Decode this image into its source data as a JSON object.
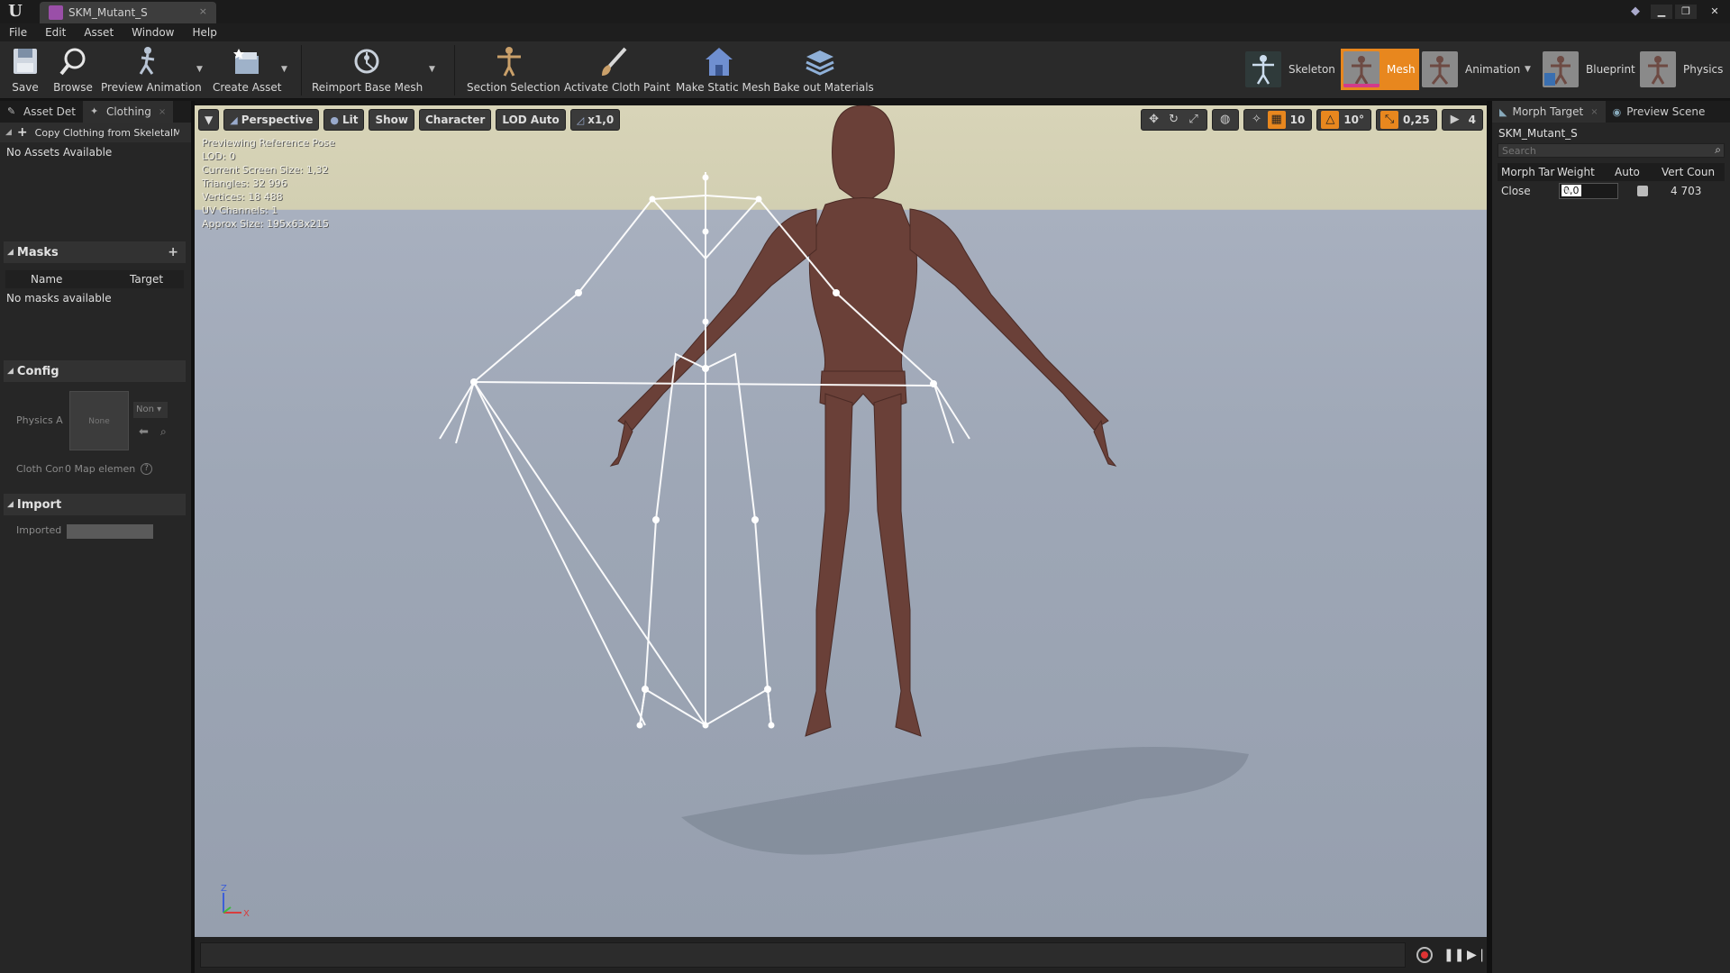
{
  "window": {
    "tab_title": "SKM_Mutant_S",
    "tab_close": "×",
    "controls": {
      "minimize": "▁",
      "restore": "❐",
      "close": "✕"
    }
  },
  "menubar": [
    "File",
    "Edit",
    "Asset",
    "Window",
    "Help"
  ],
  "toolbar": {
    "save": "Save",
    "browse": "Browse",
    "preview_animation": "Preview Animation",
    "create_asset": "Create Asset",
    "reimport_base_mesh": "Reimport Base Mesh",
    "section_selection": "Section Selection",
    "activate_cloth_paint": "Activate Cloth Paint",
    "make_static_mesh": "Make Static Mesh",
    "bake_out_materials": "Bake out Materials",
    "dropdown_arrow": "▼"
  },
  "modes": {
    "skeleton": "Skeleton",
    "mesh": "Mesh",
    "animation": "Animation",
    "blueprint": "Blueprint",
    "physics": "Physics",
    "active": "Mesh"
  },
  "left_panel": {
    "tabs": {
      "asset_details": "Asset Det",
      "clothing": "Clothing"
    },
    "copy_clothing": "Copy Clothing from SkeletalMes",
    "no_assets": "No Assets Available",
    "masks": {
      "title": "Masks",
      "col_name": "Name",
      "col_target": "Target",
      "empty": "No masks available"
    },
    "config": {
      "title": "Config",
      "physics_asset_label": "Physics A",
      "thumb_text": "None",
      "combo_value": "Non",
      "cloth_config_label": "Cloth Con",
      "map_elements": "0 Map elemen",
      "help": "?"
    },
    "import": {
      "title": "Import",
      "imported_label": "Imported I"
    }
  },
  "viewport": {
    "menu_arrow": "▼",
    "perspective": "Perspective",
    "lit": "Lit",
    "show": "Show",
    "character": "Character",
    "lod": "LOD Auto",
    "speed": "x1,0",
    "grid_snap": "10",
    "rot_snap": "10°",
    "scale_snap": "0,25",
    "camera_speed": "4",
    "stats": [
      "Previewing Reference Pose",
      "LOD: 0",
      "Current Screen Size: 1,32",
      "Triangles: 32 996",
      "Vertices: 18 488",
      "UV Channels: 1",
      "Approx Size: 195x63x215"
    ],
    "axis": {
      "z": "Z",
      "x": "X"
    }
  },
  "right_panel": {
    "tabs": {
      "morph_target": "Morph Target",
      "preview_scene": "Preview Scene"
    },
    "mesh_name": "SKM_Mutant_S",
    "search_placeholder": "Search",
    "columns": {
      "morph": "Morph Tar",
      "weight": "Weight",
      "auto": "Auto",
      "vert": "Vert Coun"
    },
    "rows": [
      {
        "name": "Close",
        "weight": "0,0",
        "vert_count": "4 703"
      }
    ]
  },
  "colors": {
    "accent": "#e8871e",
    "panel": "#262626",
    "toolbar": "#2a2a2a"
  }
}
